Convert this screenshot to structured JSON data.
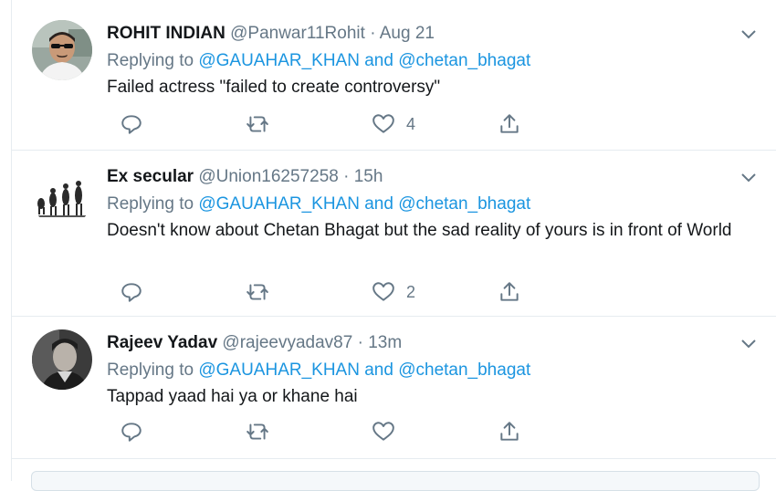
{
  "tweets": [
    {
      "name": "ROHIT INDIAN",
      "handle": "@Panwar11Rohit",
      "dot": "·",
      "time": "Aug 21",
      "replying_prefix": "Replying to",
      "mention1": "@GAUAHAR_KHAN",
      "and": "and",
      "mention2": "@chetan_bhagat",
      "text": "Failed actress \"failed to create controversy\"",
      "like_count": "4",
      "avatar_icon": "man-with-sunglasses-photo"
    },
    {
      "name": "Ex secular",
      "handle": "@Union16257258",
      "dot": "·",
      "time": "15h",
      "replying_prefix": "Replying to",
      "mention1": "@GAUAHAR_KHAN",
      "and": "and",
      "mention2": "@chetan_bhagat",
      "text": "Doesn't know about Chetan Bhagat but the sad reality of yours is in front of World",
      "like_count": "2",
      "avatar_icon": "evolution-figures-icon"
    },
    {
      "name": "Rajeev Yadav",
      "handle": "@rajeevyadav87",
      "dot": "·",
      "time": "13m",
      "replying_prefix": "Replying to",
      "mention1": "@GAUAHAR_KHAN",
      "and": "and",
      "mention2": "@chetan_bhagat",
      "text": "Tappad yaad hai ya or khane hai",
      "like_count": "",
      "avatar_icon": "man-portrait-photo"
    }
  ],
  "icons": {
    "reply": "reply-icon",
    "retweet": "retweet-icon",
    "like": "heart-icon",
    "share": "share-icon",
    "more": "chevron-down-icon"
  },
  "colors": {
    "link": "#1b95e0",
    "muted": "#657786",
    "text": "#14171a",
    "border": "#e6ecf0"
  }
}
